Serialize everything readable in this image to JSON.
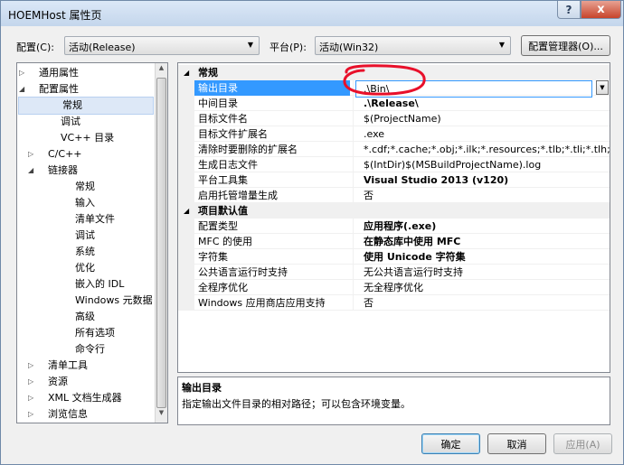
{
  "window": {
    "title": "HOEMHost 属性页"
  },
  "titlebar": {
    "help_glyph": "?",
    "close_glyph": "x"
  },
  "top": {
    "config_label": "配置(C):",
    "config_value": "活动(Release)",
    "platform_label": "平台(P):",
    "platform_value": "活动(Win32)",
    "config_manager_label": "配置管理器(O)..."
  },
  "tree": [
    {
      "label": "通用属性",
      "expander": "▷"
    },
    {
      "label": "配置属性",
      "expander": "◢"
    },
    {
      "label": "常规",
      "expander": ""
    },
    {
      "label": "调试",
      "expander": ""
    },
    {
      "label": "VC++ 目录",
      "expander": ""
    },
    {
      "label": "C/C++",
      "expander": "▷"
    },
    {
      "label": "链接器",
      "expander": "◢"
    },
    {
      "label": "常规",
      "expander": ""
    },
    {
      "label": "输入",
      "expander": ""
    },
    {
      "label": "清单文件",
      "expander": ""
    },
    {
      "label": "调试",
      "expander": ""
    },
    {
      "label": "系统",
      "expander": ""
    },
    {
      "label": "优化",
      "expander": ""
    },
    {
      "label": "嵌入的 IDL",
      "expander": ""
    },
    {
      "label": "Windows 元数据",
      "expander": ""
    },
    {
      "label": "高级",
      "expander": ""
    },
    {
      "label": "所有选项",
      "expander": ""
    },
    {
      "label": "命令行",
      "expander": ""
    },
    {
      "label": "清单工具",
      "expander": "▷"
    },
    {
      "label": "资源",
      "expander": "▷"
    },
    {
      "label": "XML 文档生成器",
      "expander": "▷"
    },
    {
      "label": "浏览信息",
      "expander": "▷"
    }
  ],
  "grid": {
    "categories": [
      {
        "label": "常规",
        "expander": "◢",
        "rows": [
          {
            "name": "输出目录",
            "value": ".\\Bin\\"
          },
          {
            "name": "中间目录",
            "value": ".\\Release\\"
          },
          {
            "name": "目标文件名",
            "value": "$(ProjectName)"
          },
          {
            "name": "目标文件扩展名",
            "value": ".exe"
          },
          {
            "name": "清除时要删除的扩展名",
            "value": "*.cdf;*.cache;*.obj;*.ilk;*.resources;*.tlb;*.tli;*.tlh;*.tmp;"
          },
          {
            "name": "生成日志文件",
            "value": "$(IntDir)$(MSBuildProjectName).log"
          },
          {
            "name": "平台工具集",
            "value": "Visual Studio 2013 (v120)"
          },
          {
            "name": "启用托管增量生成",
            "value": "否"
          }
        ]
      },
      {
        "label": "项目默认值",
        "expander": "◢",
        "rows": [
          {
            "name": "配置类型",
            "value": "应用程序(.exe)"
          },
          {
            "name": "MFC 的使用",
            "value": "在静态库中使用 MFC"
          },
          {
            "name": "字符集",
            "value": "使用 Unicode 字符集"
          },
          {
            "name": "公共语言运行时支持",
            "value": "无公共语言运行时支持"
          },
          {
            "name": "全程序优化",
            "value": "无全程序优化"
          },
          {
            "name": "Windows 应用商店应用支持",
            "value": "否"
          }
        ]
      }
    ],
    "dropdown_glyph": "▼"
  },
  "description": {
    "title": "输出目录",
    "text": "指定输出文件目录的相对路径；可以包含环境变量。"
  },
  "buttons": {
    "ok": "确定",
    "cancel": "取消",
    "apply": "应用(A)"
  },
  "colors": {
    "annotation": "#e8102a",
    "selection": "#3399ff"
  }
}
